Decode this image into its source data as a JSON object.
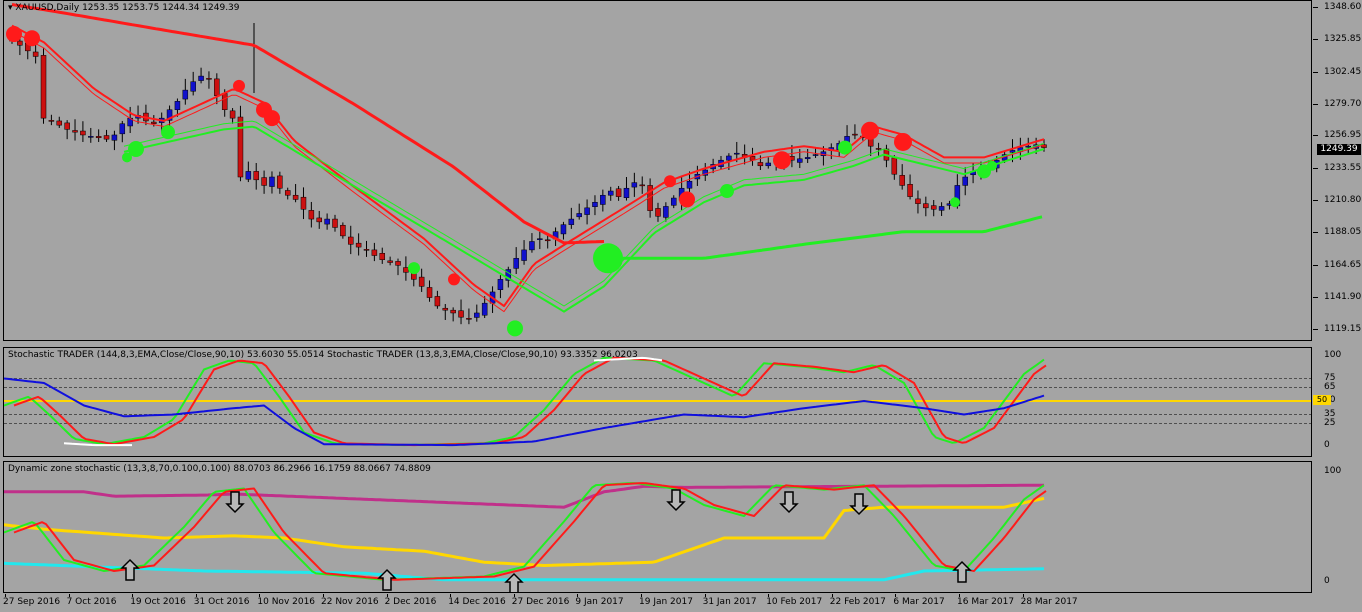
{
  "colors": {
    "background": "#a4a4a4",
    "bull_candle": "#1010cc",
    "bear_candle": "#cc1010",
    "red_line": "#ff1a1a",
    "green_line": "#22ee22",
    "blue_line": "#1010dd",
    "yellow_line": "#ffd700",
    "magenta_line": "#c0308a",
    "cyan_line": "#22e8ee",
    "white_line": "#ffffff"
  },
  "main_chart": {
    "title": "XAUUSD,Daily",
    "ohlc": "1253.35 1253.75 1244.34 1249.39",
    "current_price": "1249.39",
    "price_ticks": [
      "1348.60",
      "1325.85",
      "1302.45",
      "1279.70",
      "1256.95",
      "1233.55",
      "1210.80",
      "1188.05",
      "1164.65",
      "1141.90",
      "1119.15"
    ],
    "price_range": [
      1116,
      1350
    ],
    "close_series": [
      1325,
      1322,
      1318,
      1314,
      1270,
      1268,
      1265,
      1262,
      1260,
      1258,
      1257,
      1256,
      1255,
      1258,
      1266,
      1270,
      1272,
      1268,
      1266,
      1270,
      1276,
      1282,
      1290,
      1296,
      1300,
      1298,
      1286,
      1276,
      1270,
      1228,
      1232,
      1226,
      1222,
      1228,
      1220,
      1215,
      1212,
      1205,
      1198,
      1196,
      1198,
      1192,
      1186,
      1180,
      1178,
      1176,
      1172,
      1169,
      1167,
      1165,
      1160,
      1155,
      1150,
      1142,
      1136,
      1133,
      1131,
      1128,
      1127,
      1131,
      1138,
      1146,
      1155,
      1162,
      1170,
      1176,
      1182,
      1184,
      1183,
      1189,
      1194,
      1198,
      1202,
      1206,
      1210,
      1215,
      1218,
      1214,
      1220,
      1224,
      1222,
      1204,
      1200,
      1207,
      1213,
      1220,
      1225,
      1230,
      1233,
      1237,
      1240,
      1243,
      1245,
      1242,
      1240,
      1236,
      1238,
      1240,
      1242,
      1240,
      1241,
      1242,
      1244,
      1246,
      1249,
      1252,
      1257,
      1258,
      1256,
      1250,
      1248,
      1240,
      1230,
      1222,
      1214,
      1209,
      1206,
      1205,
      1207,
      1209,
      1222,
      1228,
      1232,
      1234,
      1236,
      1240,
      1244,
      1247,
      1249,
      1250,
      1251,
      1249
    ]
  },
  "stoch_panel": {
    "label": "Stochastic TRADER (144,8,3,EMA,Close/Close,90,10) 53.6030 55.0514  Stochastic TRADER (13,8,3,EMA,Close/Close,90,10) 93.3352 96.0203",
    "ticks": [
      "100",
      "75",
      "65",
      "50",
      "35",
      "25",
      "0"
    ],
    "level_marker": "50"
  },
  "dz_panel": {
    "label": "Dynamic zone stochastic (13,3,8,70,0.100,0.100) 88.0703 86.2966 16.1759 88.0667 74.8809",
    "ticks": [
      "100",
      "0"
    ]
  },
  "time_axis": [
    "27 Sep 2016",
    "7 Oct 2016",
    "19 Oct 2016",
    "31 Oct 2016",
    "10 Nov 2016",
    "22 Nov 2016",
    "2 Dec 2016",
    "14 Dec 2016",
    "27 Dec 2016",
    "9 Jan 2017",
    "19 Jan 2017",
    "31 Jan 2017",
    "10 Feb 2017",
    "22 Feb 2017",
    "6 Mar 2017",
    "16 Mar 2017",
    "28 Mar 2017"
  ]
}
